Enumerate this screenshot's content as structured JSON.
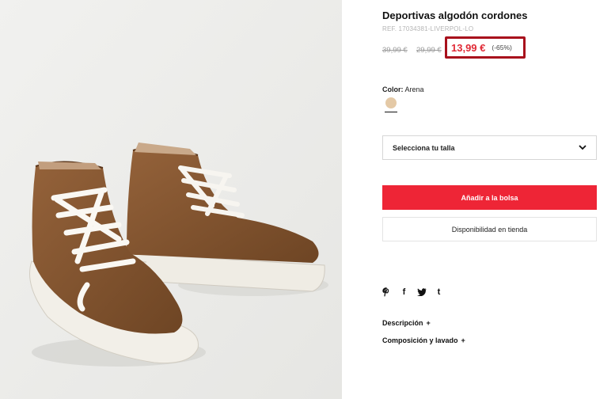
{
  "product": {
    "title": "Deportivas algodón cordones",
    "ref": "REF. 17034381-LIVERPOL-LO",
    "old_price_1": "39,99 €",
    "old_price_2": "29,99 €",
    "price": "13,99 €",
    "discount": "(-65%)"
  },
  "color": {
    "label": "Color:",
    "value": "Arena",
    "swatch_hex": "#e4c9a6"
  },
  "size": {
    "placeholder": "Selecciona tu talla"
  },
  "actions": {
    "add_to_bag": "Añadir a la bolsa",
    "store_availability": "Disponibilidad en tienda"
  },
  "social": {
    "icons": [
      "pinterest-icon",
      "facebook-icon",
      "twitter-icon",
      "tumblr-icon"
    ],
    "facebook": "f",
    "tumblr": "t"
  },
  "details": {
    "description": "Descripción",
    "composition": "Composición y lavado",
    "expand_symbol": "+"
  },
  "colors": {
    "accent_red": "#ee2536",
    "price_red": "#e02a36",
    "highlight_border": "#a8101c"
  }
}
